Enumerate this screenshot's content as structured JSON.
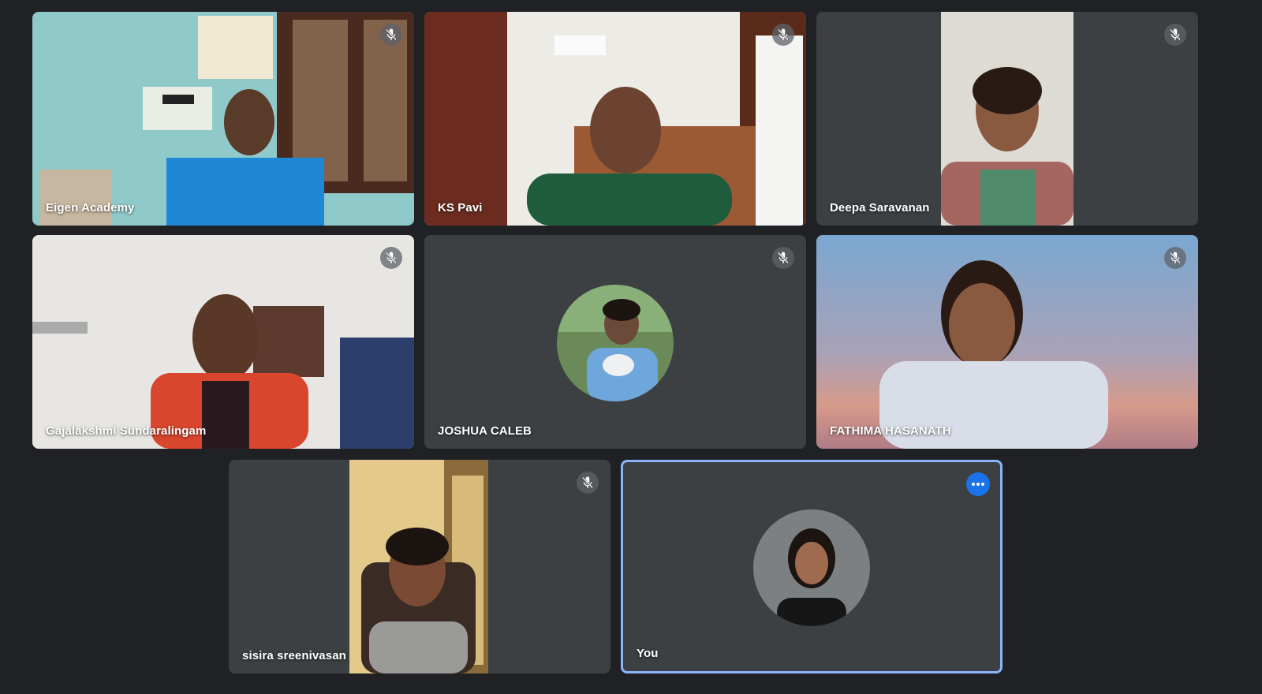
{
  "meeting": {
    "participants": [
      {
        "name": "Eigen Academy",
        "muted": true
      },
      {
        "name": "KS Pavi",
        "muted": true
      },
      {
        "name": "Deepa Saravanan",
        "muted": true
      },
      {
        "name": "Gajalakshmi Sundaralingam",
        "muted": true
      },
      {
        "name": "JOSHUA CALEB",
        "muted": true
      },
      {
        "name": "FATHIMA HASANATH",
        "muted": true
      },
      {
        "name": "sisira sreenivasan",
        "muted": true
      },
      {
        "name": "You",
        "muted": false
      }
    ]
  },
  "icons": {
    "mic_off": "mic-off-icon",
    "more_options": "more-options-icon"
  },
  "colors": {
    "background": "#202124",
    "tile": "#3c4043",
    "self_border": "#8ab4f8",
    "accent": "#1a73e8"
  }
}
